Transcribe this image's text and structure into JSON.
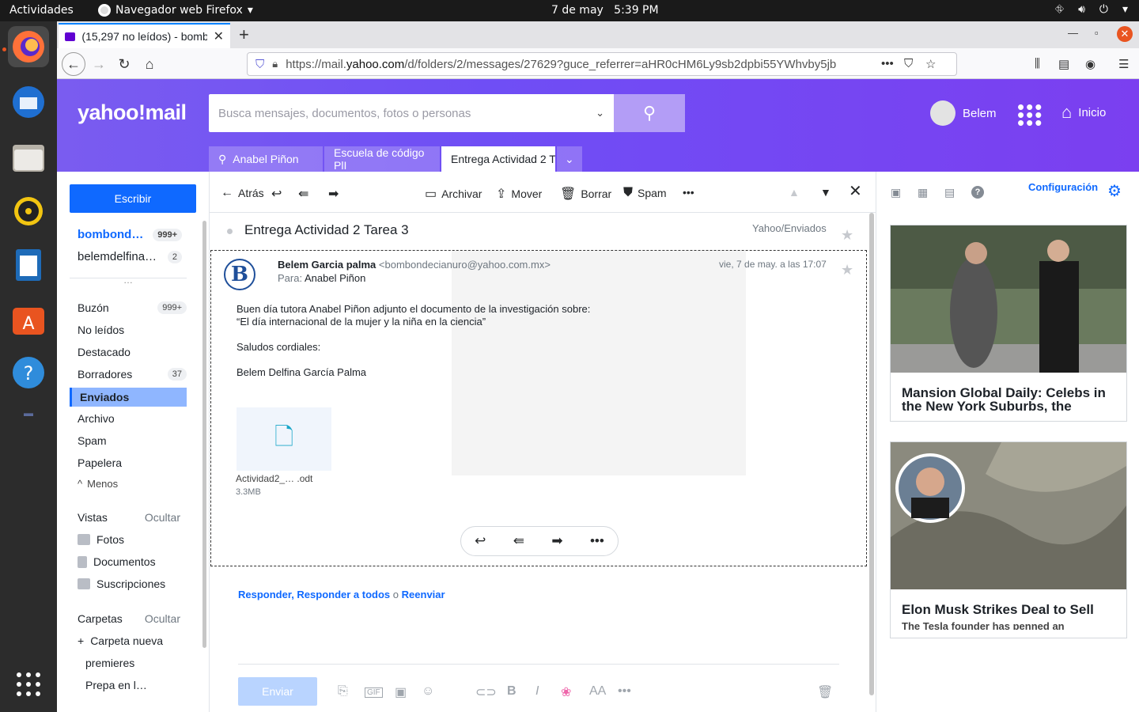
{
  "topbar": {
    "activities": "Actividades",
    "app": "Navegador web Firefox",
    "date": "7 de may",
    "time": "5:39 PM"
  },
  "browser": {
    "tab_title": "(15,297 no leídos) - bomb",
    "url_prefix": "https://mail.",
    "url_domain": "yahoo.com",
    "url_rest": "/d/folders/2/messages/27629?guce_referrer=aHR0cHM6Ly9sb2dpbi55YWhvby5jb"
  },
  "yahoo": {
    "logo": "yahoo!mail",
    "search_placeholder": "Busca mensajes, documentos, fotos o personas",
    "user": "Belem",
    "home": "Inicio",
    "tabs": [
      "Anabel Piñon",
      "Escuela de código PlI",
      "Entrega Actividad 2 T"
    ]
  },
  "sidebar": {
    "compose": "Escribir",
    "accounts": [
      {
        "name": "bombond…",
        "badge": "999+"
      },
      {
        "name": "belemdelfina…",
        "badge": "2"
      }
    ],
    "more": "…",
    "folders": [
      {
        "name": "Buzón",
        "count": "999+"
      },
      {
        "name": "No leídos",
        "count": ""
      },
      {
        "name": "Destacado",
        "count": ""
      },
      {
        "name": "Borradores",
        "count": "37"
      },
      {
        "name": "Enviados",
        "count": ""
      },
      {
        "name": "Archivo",
        "count": ""
      },
      {
        "name": "Spam",
        "count": ""
      },
      {
        "name": "Papelera",
        "count": ""
      }
    ],
    "less": "Menos",
    "views_title": "Vistas",
    "views_hide": "Ocultar",
    "views": [
      "Fotos",
      "Documentos",
      "Suscripciones"
    ],
    "folders_title": "Carpetas",
    "folders_hide": "Ocultar",
    "new_folder": "Carpeta nueva",
    "custom_folders": [
      "premieres",
      "Prepa en l…"
    ]
  },
  "toolbar": {
    "back": "Atrás",
    "archive": "Archivar",
    "move": "Mover",
    "delete": "Borrar",
    "spam": "Spam"
  },
  "message": {
    "subject": "Entrega Actividad 2 Tarea 3",
    "folder": "Yahoo/Enviados",
    "from_name": "Belem Garcia palma",
    "from_email": "<bombondecianuro@yahoo.com.mx>",
    "to_label": "Para:",
    "to": "Anabel Piñon",
    "date": "vie, 7 de may. a las 17:07",
    "body": [
      "Buen día tutora Anabel Piñon adjunto el documento de la investigación sobre:",
      "“El día internacional de la mujer y la niña en la ciencia”",
      "",
      "Saludos cordiales:",
      "",
      "Belem Delfina García Palma"
    ],
    "attachment_name": "Actividad2_… .odt",
    "attachment_size": "3.3MB"
  },
  "reply": {
    "reply": "Responder",
    "reply_all": "Responder a todos",
    "or": "o",
    "forward": "Reenviar",
    "send": "Enviar"
  },
  "rail": {
    "settings": "Configuración"
  },
  "ads": [
    {
      "headline": "Mansion Global Daily: Celebs in the New York Suburbs, the Affordability Crisis and More"
    },
    {
      "headline": "Elon Musk Strikes Deal to Sell Multiple Homes in Los Angeles",
      "sub": "The Tesla founder has penned an"
    }
  ]
}
